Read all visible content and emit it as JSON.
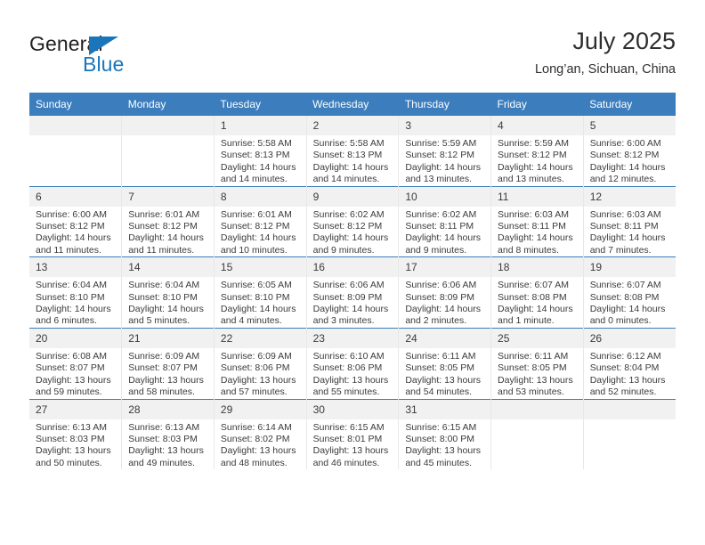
{
  "brand": {
    "name_part1": "General",
    "name_part2": "Blue",
    "triangle_icon": "triangle-icon",
    "colors": {
      "blue": "#1b75bb",
      "dark": "#231f20"
    }
  },
  "header": {
    "month_title": "July 2025",
    "location": "Long’an, Sichuan, China"
  },
  "calendar": {
    "accent_color": "#3b7dbd",
    "daynum_band_color": "#f1f1f1",
    "weekday_headers": [
      "Sunday",
      "Monday",
      "Tuesday",
      "Wednesday",
      "Thursday",
      "Friday",
      "Saturday"
    ],
    "weeks": [
      [
        {
          "day": "",
          "sunrise": "",
          "sunset": "",
          "daylight_line1": "",
          "daylight_line2": ""
        },
        {
          "day": "",
          "sunrise": "",
          "sunset": "",
          "daylight_line1": "",
          "daylight_line2": ""
        },
        {
          "day": "1",
          "sunrise": "Sunrise: 5:58 AM",
          "sunset": "Sunset: 8:13 PM",
          "daylight_line1": "Daylight: 14 hours",
          "daylight_line2": "and 14 minutes."
        },
        {
          "day": "2",
          "sunrise": "Sunrise: 5:58 AM",
          "sunset": "Sunset: 8:13 PM",
          "daylight_line1": "Daylight: 14 hours",
          "daylight_line2": "and 14 minutes."
        },
        {
          "day": "3",
          "sunrise": "Sunrise: 5:59 AM",
          "sunset": "Sunset: 8:12 PM",
          "daylight_line1": "Daylight: 14 hours",
          "daylight_line2": "and 13 minutes."
        },
        {
          "day": "4",
          "sunrise": "Sunrise: 5:59 AM",
          "sunset": "Sunset: 8:12 PM",
          "daylight_line1": "Daylight: 14 hours",
          "daylight_line2": "and 13 minutes."
        },
        {
          "day": "5",
          "sunrise": "Sunrise: 6:00 AM",
          "sunset": "Sunset: 8:12 PM",
          "daylight_line1": "Daylight: 14 hours",
          "daylight_line2": "and 12 minutes."
        }
      ],
      [
        {
          "day": "6",
          "sunrise": "Sunrise: 6:00 AM",
          "sunset": "Sunset: 8:12 PM",
          "daylight_line1": "Daylight: 14 hours",
          "daylight_line2": "and 11 minutes."
        },
        {
          "day": "7",
          "sunrise": "Sunrise: 6:01 AM",
          "sunset": "Sunset: 8:12 PM",
          "daylight_line1": "Daylight: 14 hours",
          "daylight_line2": "and 11 minutes."
        },
        {
          "day": "8",
          "sunrise": "Sunrise: 6:01 AM",
          "sunset": "Sunset: 8:12 PM",
          "daylight_line1": "Daylight: 14 hours",
          "daylight_line2": "and 10 minutes."
        },
        {
          "day": "9",
          "sunrise": "Sunrise: 6:02 AM",
          "sunset": "Sunset: 8:12 PM",
          "daylight_line1": "Daylight: 14 hours",
          "daylight_line2": "and 9 minutes."
        },
        {
          "day": "10",
          "sunrise": "Sunrise: 6:02 AM",
          "sunset": "Sunset: 8:11 PM",
          "daylight_line1": "Daylight: 14 hours",
          "daylight_line2": "and 9 minutes."
        },
        {
          "day": "11",
          "sunrise": "Sunrise: 6:03 AM",
          "sunset": "Sunset: 8:11 PM",
          "daylight_line1": "Daylight: 14 hours",
          "daylight_line2": "and 8 minutes."
        },
        {
          "day": "12",
          "sunrise": "Sunrise: 6:03 AM",
          "sunset": "Sunset: 8:11 PM",
          "daylight_line1": "Daylight: 14 hours",
          "daylight_line2": "and 7 minutes."
        }
      ],
      [
        {
          "day": "13",
          "sunrise": "Sunrise: 6:04 AM",
          "sunset": "Sunset: 8:10 PM",
          "daylight_line1": "Daylight: 14 hours",
          "daylight_line2": "and 6 minutes."
        },
        {
          "day": "14",
          "sunrise": "Sunrise: 6:04 AM",
          "sunset": "Sunset: 8:10 PM",
          "daylight_line1": "Daylight: 14 hours",
          "daylight_line2": "and 5 minutes."
        },
        {
          "day": "15",
          "sunrise": "Sunrise: 6:05 AM",
          "sunset": "Sunset: 8:10 PM",
          "daylight_line1": "Daylight: 14 hours",
          "daylight_line2": "and 4 minutes."
        },
        {
          "day": "16",
          "sunrise": "Sunrise: 6:06 AM",
          "sunset": "Sunset: 8:09 PM",
          "daylight_line1": "Daylight: 14 hours",
          "daylight_line2": "and 3 minutes."
        },
        {
          "day": "17",
          "sunrise": "Sunrise: 6:06 AM",
          "sunset": "Sunset: 8:09 PM",
          "daylight_line1": "Daylight: 14 hours",
          "daylight_line2": "and 2 minutes."
        },
        {
          "day": "18",
          "sunrise": "Sunrise: 6:07 AM",
          "sunset": "Sunset: 8:08 PM",
          "daylight_line1": "Daylight: 14 hours",
          "daylight_line2": "and 1 minute."
        },
        {
          "day": "19",
          "sunrise": "Sunrise: 6:07 AM",
          "sunset": "Sunset: 8:08 PM",
          "daylight_line1": "Daylight: 14 hours",
          "daylight_line2": "and 0 minutes."
        }
      ],
      [
        {
          "day": "20",
          "sunrise": "Sunrise: 6:08 AM",
          "sunset": "Sunset: 8:07 PM",
          "daylight_line1": "Daylight: 13 hours",
          "daylight_line2": "and 59 minutes."
        },
        {
          "day": "21",
          "sunrise": "Sunrise: 6:09 AM",
          "sunset": "Sunset: 8:07 PM",
          "daylight_line1": "Daylight: 13 hours",
          "daylight_line2": "and 58 minutes."
        },
        {
          "day": "22",
          "sunrise": "Sunrise: 6:09 AM",
          "sunset": "Sunset: 8:06 PM",
          "daylight_line1": "Daylight: 13 hours",
          "daylight_line2": "and 57 minutes."
        },
        {
          "day": "23",
          "sunrise": "Sunrise: 6:10 AM",
          "sunset": "Sunset: 8:06 PM",
          "daylight_line1": "Daylight: 13 hours",
          "daylight_line2": "and 55 minutes."
        },
        {
          "day": "24",
          "sunrise": "Sunrise: 6:11 AM",
          "sunset": "Sunset: 8:05 PM",
          "daylight_line1": "Daylight: 13 hours",
          "daylight_line2": "and 54 minutes."
        },
        {
          "day": "25",
          "sunrise": "Sunrise: 6:11 AM",
          "sunset": "Sunset: 8:05 PM",
          "daylight_line1": "Daylight: 13 hours",
          "daylight_line2": "and 53 minutes."
        },
        {
          "day": "26",
          "sunrise": "Sunrise: 6:12 AM",
          "sunset": "Sunset: 8:04 PM",
          "daylight_line1": "Daylight: 13 hours",
          "daylight_line2": "and 52 minutes."
        }
      ],
      [
        {
          "day": "27",
          "sunrise": "Sunrise: 6:13 AM",
          "sunset": "Sunset: 8:03 PM",
          "daylight_line1": "Daylight: 13 hours",
          "daylight_line2": "and 50 minutes."
        },
        {
          "day": "28",
          "sunrise": "Sunrise: 6:13 AM",
          "sunset": "Sunset: 8:03 PM",
          "daylight_line1": "Daylight: 13 hours",
          "daylight_line2": "and 49 minutes."
        },
        {
          "day": "29",
          "sunrise": "Sunrise: 6:14 AM",
          "sunset": "Sunset: 8:02 PM",
          "daylight_line1": "Daylight: 13 hours",
          "daylight_line2": "and 48 minutes."
        },
        {
          "day": "30",
          "sunrise": "Sunrise: 6:15 AM",
          "sunset": "Sunset: 8:01 PM",
          "daylight_line1": "Daylight: 13 hours",
          "daylight_line2": "and 46 minutes."
        },
        {
          "day": "31",
          "sunrise": "Sunrise: 6:15 AM",
          "sunset": "Sunset: 8:00 PM",
          "daylight_line1": "Daylight: 13 hours",
          "daylight_line2": "and 45 minutes."
        },
        {
          "day": "",
          "sunrise": "",
          "sunset": "",
          "daylight_line1": "",
          "daylight_line2": ""
        },
        {
          "day": "",
          "sunrise": "",
          "sunset": "",
          "daylight_line1": "",
          "daylight_line2": ""
        }
      ]
    ]
  }
}
